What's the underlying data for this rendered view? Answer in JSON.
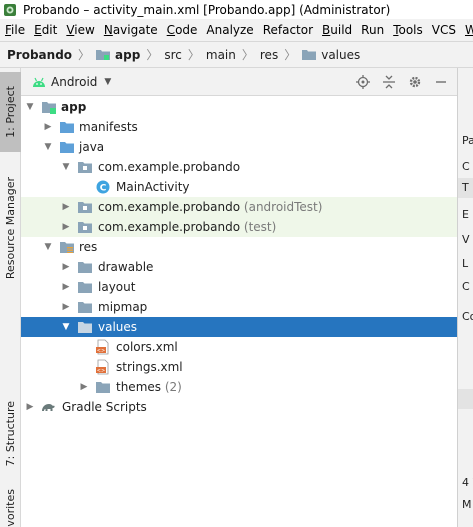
{
  "window": {
    "title": "Probando – activity_main.xml [Probando.app] (Administrator)"
  },
  "menu": [
    {
      "u": "F",
      "rest": "ile"
    },
    {
      "u": "E",
      "rest": "dit"
    },
    {
      "u": "V",
      "rest": "iew"
    },
    {
      "u": "N",
      "rest": "avigate"
    },
    {
      "u": "C",
      "rest": "ode"
    },
    {
      "u": "",
      "rest": "Analyze"
    },
    {
      "u": "",
      "rest": "Refactor"
    },
    {
      "u": "B",
      "rest": "uild"
    },
    {
      "u": "",
      "rest": "Run"
    },
    {
      "u": "T",
      "rest": "ools"
    },
    {
      "u": "",
      "rest": "VCS"
    },
    {
      "u": "W",
      "rest": ""
    }
  ],
  "breadcrumb": [
    "Probando",
    "app",
    "src",
    "main",
    "res",
    "values"
  ],
  "left_strip": {
    "project_tab": "1: Project",
    "resource_manager_tab": "Resource Manager",
    "structure_tab": "7: Structure",
    "favorites_tab": "vorites"
  },
  "panel": {
    "view_mode": "Android"
  },
  "tree": {
    "app": "app",
    "manifests": "manifests",
    "java": "java",
    "pkg_main": "com.example.probando",
    "main_activity": "MainActivity",
    "pkg_android_test": "com.example.probando",
    "pkg_android_test_suffix": "(androidTest)",
    "pkg_test": "com.example.probando",
    "pkg_test_suffix": "(test)",
    "res": "res",
    "drawable": "drawable",
    "layout": "layout",
    "mipmap": "mipmap",
    "values": "values",
    "colors_xml": "colors.xml",
    "strings_xml": "strings.xml",
    "themes": "themes",
    "themes_count": "(2)",
    "gradle_scripts": "Gradle Scripts"
  },
  "right_panel": {
    "items": [
      "Pa",
      "C",
      "T",
      "E",
      "V",
      "L",
      "C",
      "Co",
      "4 W",
      "M"
    ]
  },
  "colors": {
    "selection": "#2675bf",
    "test_tint": "#eff7e9",
    "folder": "#8aa4b8",
    "folder_blue": "#5ea0d8",
    "android_green": "#3ddc84"
  }
}
